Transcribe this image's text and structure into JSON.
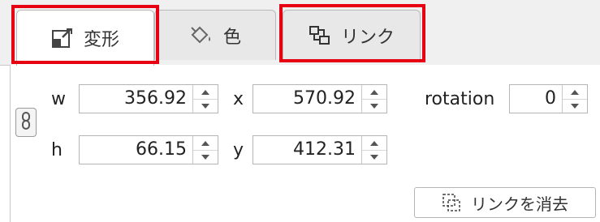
{
  "tabs": [
    {
      "label": "変形",
      "icon": "transform-icon",
      "active": true
    },
    {
      "label": "色",
      "icon": "paint-bucket-icon",
      "active": false
    },
    {
      "label": "リンク",
      "icon": "link-nodes-icon",
      "active": false
    }
  ],
  "fields": {
    "w": {
      "label": "w",
      "value": "356.92"
    },
    "h": {
      "label": "h",
      "value": "66.15"
    },
    "x": {
      "label": "x",
      "value": "570.92"
    },
    "y": {
      "label": "y",
      "value": "412.31"
    },
    "rotation": {
      "label": "rotation",
      "value": "0"
    }
  },
  "clear_link_button": {
    "label": "リンクを消去",
    "icon": "dashed-link-icon"
  },
  "colors": {
    "highlight": "#e60012"
  }
}
